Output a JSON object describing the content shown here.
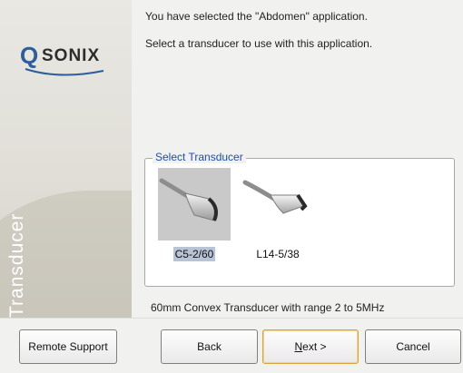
{
  "brand": {
    "logo_q": "Q",
    "logo_rest": "SONIX",
    "side_title": "Transducer"
  },
  "main": {
    "selected_message": "You have selected the \"Abdomen\" application.",
    "instruction": "Select a transducer to use with this application.",
    "group_title": "Select Transducer",
    "transducers": [
      {
        "label": "C5-2/60",
        "selected": true,
        "icon": "convex-transducer-icon"
      },
      {
        "label": "L14-5/38",
        "selected": false,
        "icon": "linear-transducer-icon"
      }
    ],
    "description": "60mm Convex Transducer with range 2 to 5MHz"
  },
  "buttons": {
    "remote_support": "Remote Support",
    "back": "Back",
    "next_mnemonic": "N",
    "next_rest": "ext >",
    "cancel": "Cancel"
  },
  "colors": {
    "accent_blue": "#2d5d9a",
    "group_title": "#1a4fb0",
    "selection": "#b9c3d6",
    "default_button_border": "#d9a23a"
  }
}
